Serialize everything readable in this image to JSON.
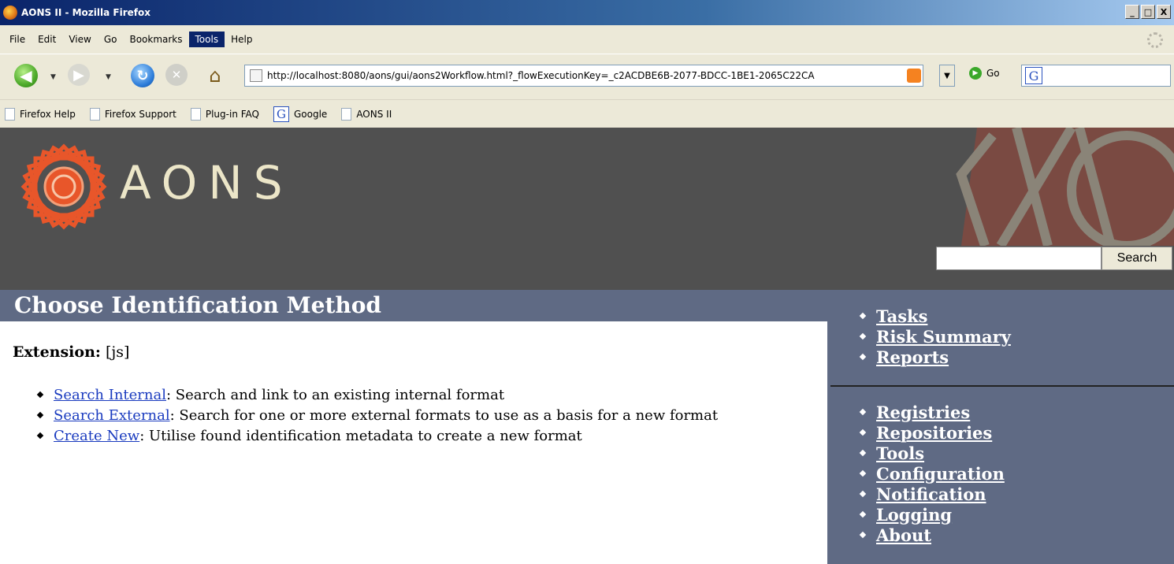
{
  "window": {
    "title": "AONS II - Mozilla Firefox",
    "controls": [
      "_",
      "□",
      "X"
    ]
  },
  "menubar": {
    "items": [
      "File",
      "Edit",
      "View",
      "Go",
      "Bookmarks",
      "Tools",
      "Help"
    ],
    "active": "Tools"
  },
  "navbar": {
    "url": "http://localhost:8080/aons/gui/aons2Workflow.html?_flowExecutionKey=_c2ACDBE6B-2077-BDCC-1BE1-2065C22CA",
    "go_label": "Go",
    "search_value": ""
  },
  "bookmarks": [
    {
      "label": "Firefox Help",
      "icon": "page-icon"
    },
    {
      "label": "Firefox Support",
      "icon": "page-icon"
    },
    {
      "label": "Plug-in FAQ",
      "icon": "page-icon"
    },
    {
      "label": "Google",
      "icon": "google-icon"
    },
    {
      "label": "AONS II",
      "icon": "page-icon"
    }
  ],
  "header": {
    "logo_text": "AONS",
    "search_value": "",
    "search_button": "Search"
  },
  "main": {
    "title": "Choose Identification Method",
    "extension_label": "Extension:",
    "extension_value": "[js]",
    "options": [
      {
        "link": "Search Internal",
        "description": ": Search and link to an existing internal format"
      },
      {
        "link": "Search External",
        "description": ": Search for one or more external formats to use as a basis for a new format"
      },
      {
        "link": "Create New",
        "description": ": Utilise found identification metadata to create a new format"
      }
    ]
  },
  "sidebar": {
    "group1": [
      "Tasks",
      "Risk Summary",
      "Reports"
    ],
    "group2": [
      "Registries",
      "Repositories",
      "Tools",
      "Configuration",
      "Notification",
      "Logging",
      "About"
    ]
  },
  "colors": {
    "header_bg": "#505050",
    "band_bg": "#5f6a84",
    "logo_orange": "#e8562a",
    "link_blue": "#1a3bbf"
  }
}
